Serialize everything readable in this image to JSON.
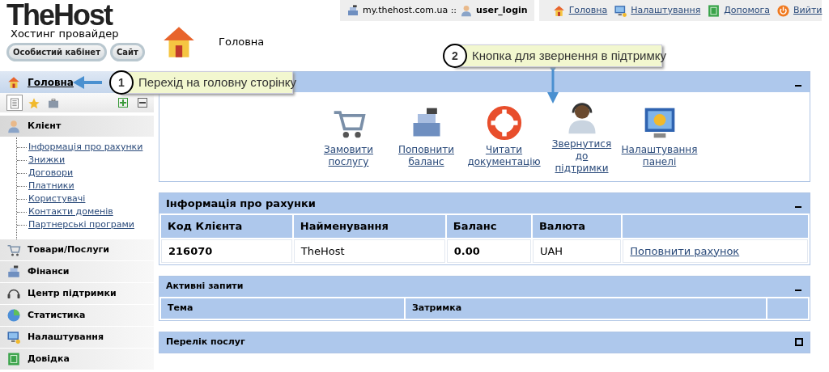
{
  "logo": {
    "name": "TheHost",
    "tagline": "Хостинг провайдер"
  },
  "header_buttons": [
    "Особистий кабінет",
    "Сайт"
  ],
  "page_title": "Головна",
  "top_bar": {
    "host": "my.thehost.com.ua ::",
    "user": "user_login",
    "links": [
      {
        "label": "Головна",
        "kind": "home"
      },
      {
        "label": "Налаштування",
        "kind": "monitor"
      },
      {
        "label": "Допомога",
        "kind": "help"
      },
      {
        "label": "Вийти",
        "kind": "power"
      }
    ]
  },
  "sidebar": {
    "home_link": "Головна",
    "tools": [
      {
        "kind": "list",
        "selected": true
      },
      {
        "kind": "star",
        "selected": false
      },
      {
        "kind": "briefcase",
        "selected": false
      }
    ],
    "sections": [
      {
        "label": "Клієнт",
        "kind": "client",
        "expanded": true,
        "children": [
          {
            "label": "Інформація про рахунки"
          },
          {
            "label": "Знижки"
          },
          {
            "label": "Договори"
          },
          {
            "label": "Платники"
          },
          {
            "label": "Користувачі"
          },
          {
            "label": "Контакти доменів"
          },
          {
            "label": "Партнерські програми"
          }
        ]
      },
      {
        "label": "Товари/Послуги",
        "kind": "cart",
        "expanded": false
      },
      {
        "label": "Фінанси",
        "kind": "register",
        "expanded": false
      },
      {
        "label": "Центр підтримки",
        "kind": "headset",
        "expanded": false
      },
      {
        "label": "Статистика",
        "kind": "chart",
        "expanded": false
      },
      {
        "label": "Налаштування",
        "kind": "monitor",
        "expanded": false
      },
      {
        "label": "Довідка",
        "kind": "help",
        "expanded": false
      }
    ]
  },
  "quick_actions": {
    "collapsed": false,
    "items": [
      {
        "label": "Замовити\nпослугу",
        "kind": "cart"
      },
      {
        "label": "Поповнити\nбаланс",
        "kind": "register"
      },
      {
        "label": "Читати\nдокументацію",
        "kind": "lifebuoy"
      },
      {
        "label": "Звернутися\nдо підтримки",
        "kind": "operator"
      },
      {
        "label": "Налаштування\nпанелі",
        "kind": "gear"
      }
    ]
  },
  "account_info": {
    "title": "Інформація про рахунки",
    "collapsed": false,
    "columns": [
      "Код Клієнта",
      "Найменування",
      "Баланс",
      "Валюта"
    ],
    "rows": [
      [
        {
          "text": "216070",
          "kind": "strong"
        },
        {
          "text": "TheHost",
          "kind": "plain"
        },
        {
          "text": "0.00",
          "kind": "strong"
        },
        {
          "text": "UAH",
          "kind": "plain"
        },
        {
          "text": "Поповнити рахунок",
          "kind": "link"
        }
      ]
    ]
  },
  "active_requests": {
    "title": "Активні запити",
    "collapsed": false,
    "columns": [
      "Тема",
      "Затримка"
    ]
  },
  "services": {
    "title": "Перелік послуг",
    "collapsed": true
  },
  "callouts": [
    {
      "number": "1",
      "text": "Перехід на головну сторінку"
    },
    {
      "number": "2",
      "text": "Кнопка для звернення в підтримку"
    }
  ]
}
